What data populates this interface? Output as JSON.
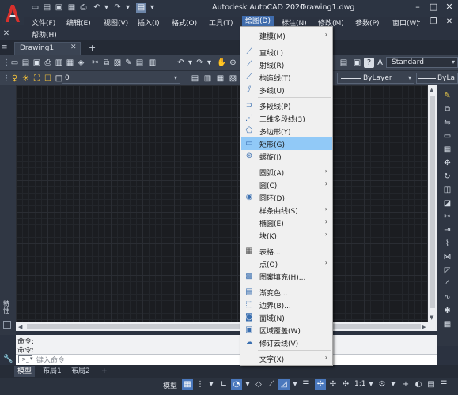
{
  "window": {
    "app_title": "Autodesk AutoCAD 2020",
    "doc_title": "Drawing1.dwg",
    "minimize": "–",
    "restore": "□",
    "close": "✕"
  },
  "menu": {
    "items": [
      "文件(F)",
      "编辑(E)",
      "视图(V)",
      "插入(I)",
      "格式(O)",
      "工具(T)",
      "绘图(D)",
      "标注(N)",
      "修改(M)",
      "参数(P)",
      "窗口(W)"
    ],
    "help": "帮助(H)"
  },
  "tabs": {
    "drawing": "Drawing1",
    "close": "✕",
    "add": "+"
  },
  "toolbar": {
    "style_combo": "Standard",
    "layer_combo1": "ByLayer",
    "layer_combo2": "ByLa",
    "layer_value": "0"
  },
  "draw_menu": {
    "items": [
      {
        "label": "建模(M)",
        "icon": "",
        "submenu": true
      },
      {
        "label": "直线(L)",
        "icon": "line-icon",
        "submenu": false
      },
      {
        "label": "射线(R)",
        "icon": "ray-icon",
        "submenu": false
      },
      {
        "label": "构造线(T)",
        "icon": "xline-icon",
        "submenu": false
      },
      {
        "label": "多线(U)",
        "icon": "mline-icon",
        "submenu": false
      },
      {
        "label": "多段线(P)",
        "icon": "polyline-icon",
        "submenu": false
      },
      {
        "label": "三维多段线(3)",
        "icon": "3dpolyline-icon",
        "submenu": false
      },
      {
        "label": "多边形(Y)",
        "icon": "polygon-icon",
        "submenu": false
      },
      {
        "label": "矩形(G)",
        "icon": "rectangle-icon",
        "submenu": false,
        "highlighted": true
      },
      {
        "label": "螺旋(I)",
        "icon": "helix-icon",
        "submenu": false
      },
      {
        "label": "圆弧(A)",
        "icon": "",
        "submenu": true
      },
      {
        "label": "圆(C)",
        "icon": "",
        "submenu": true
      },
      {
        "label": "圆环(D)",
        "icon": "donut-icon",
        "submenu": false
      },
      {
        "label": "样条曲线(S)",
        "icon": "",
        "submenu": true
      },
      {
        "label": "椭圆(E)",
        "icon": "",
        "submenu": true
      },
      {
        "label": "块(K)",
        "icon": "",
        "submenu": true
      },
      {
        "label": "表格...",
        "icon": "table-icon",
        "submenu": false
      },
      {
        "label": "点(O)",
        "icon": "",
        "submenu": true
      },
      {
        "label": "图案填充(H)...",
        "icon": "hatch-icon",
        "submenu": false
      },
      {
        "label": "渐变色...",
        "icon": "gradient-icon",
        "submenu": false
      },
      {
        "label": "边界(B)...",
        "icon": "boundary-icon",
        "submenu": false
      },
      {
        "label": "面域(N)",
        "icon": "region-icon",
        "submenu": false
      },
      {
        "label": "区域覆盖(W)",
        "icon": "wipeout-icon",
        "submenu": false
      },
      {
        "label": "修订云线(V)",
        "icon": "revcloud-icon",
        "submenu": false
      },
      {
        "label": "文字(X)",
        "icon": "",
        "submenu": true
      }
    ]
  },
  "command": {
    "line1": "命令:",
    "line2": "命令:",
    "placeholder": "键入命令"
  },
  "left_label": "特性",
  "layout_tabs": [
    "模型",
    "布局1",
    "布局2"
  ],
  "status": {
    "model": "模型",
    "scale": "1:1"
  },
  "colors": {
    "accent": "#3f6cad",
    "menu_highlight": "#91c9f7"
  }
}
